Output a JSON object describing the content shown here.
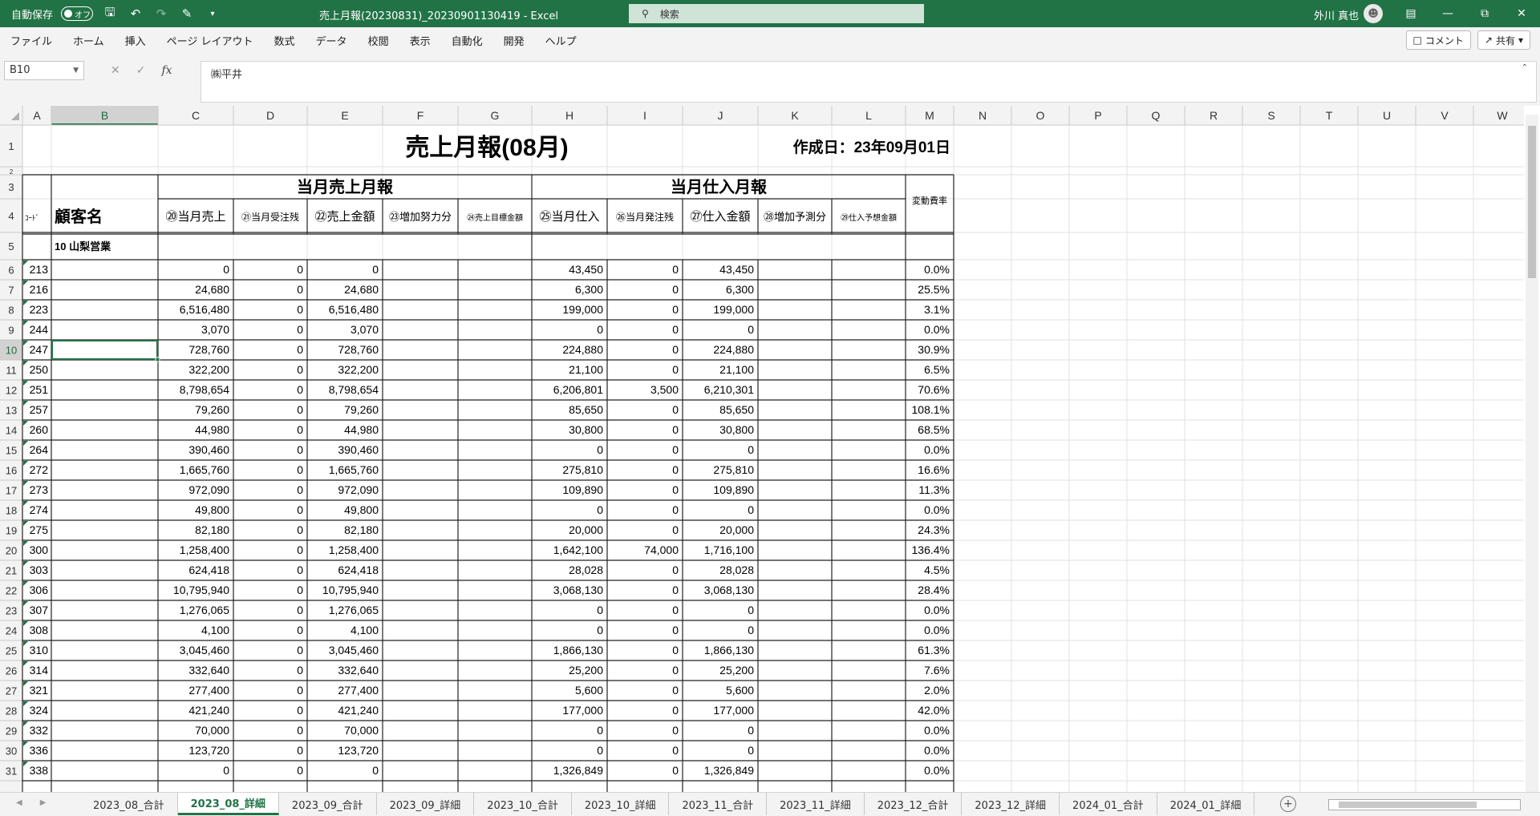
{
  "titlebar": {
    "autosave_label": "自動保存",
    "autosave_state": "オフ",
    "doc_title": "売上月報(20230831)_20230901130419  -  Excel",
    "search_placeholder": "検索",
    "user_name": "外川 真也"
  },
  "menu": [
    "ファイル",
    "ホーム",
    "挿入",
    "ページ レイアウト",
    "数式",
    "データ",
    "校閲",
    "表示",
    "自動化",
    "開発",
    "ヘルプ"
  ],
  "menu_right": {
    "comment": "コメント",
    "share": "共有"
  },
  "formula_bar": {
    "name_box": "B10",
    "formula": "㈱平井"
  },
  "columns": [
    "A",
    "B",
    "C",
    "D",
    "E",
    "F",
    "G",
    "H",
    "I",
    "J",
    "K",
    "L",
    "M",
    "N",
    "O",
    "P",
    "Q",
    "R",
    "S",
    "T",
    "U",
    "V",
    "W"
  ],
  "report": {
    "title": "売上月報(08月)",
    "created": "作成日：23年09月01日",
    "group_sales": "当月売上月報",
    "group_purchase": "当月仕入月報",
    "variable_cost_rate": "変動費率",
    "code": "ｺｰﾄﾞ",
    "customer": "顧客名",
    "col_headers": [
      "⑳当月売上",
      "㉑当月受注残",
      "㉒売上金額",
      "㉓増加努力分",
      "㉔売上目標金額",
      "㉕当月仕入",
      "㉖当月発注残",
      "㉗仕入金額",
      "㉘増加予測分",
      "㉙仕入予想金額"
    ],
    "section": "10 山梨営業"
  },
  "rows": [
    {
      "code": "213",
      "sales": "0",
      "order": "0",
      "amount": "0",
      "purchase": "43,450",
      "porder": "0",
      "pamount": "43,450",
      "rate": "0.0%"
    },
    {
      "code": "216",
      "sales": "24,680",
      "order": "0",
      "amount": "24,680",
      "purchase": "6,300",
      "porder": "0",
      "pamount": "6,300",
      "rate": "25.5%"
    },
    {
      "code": "223",
      "sales": "6,516,480",
      "order": "0",
      "amount": "6,516,480",
      "purchase": "199,000",
      "porder": "0",
      "pamount": "199,000",
      "rate": "3.1%"
    },
    {
      "code": "244",
      "sales": "3,070",
      "order": "0",
      "amount": "3,070",
      "purchase": "0",
      "porder": "0",
      "pamount": "0",
      "rate": "0.0%"
    },
    {
      "code": "247",
      "sales": "728,760",
      "order": "0",
      "amount": "728,760",
      "purchase": "224,880",
      "porder": "0",
      "pamount": "224,880",
      "rate": "30.9%"
    },
    {
      "code": "250",
      "sales": "322,200",
      "order": "0",
      "amount": "322,200",
      "purchase": "21,100",
      "porder": "0",
      "pamount": "21,100",
      "rate": "6.5%"
    },
    {
      "code": "251",
      "sales": "8,798,654",
      "order": "0",
      "amount": "8,798,654",
      "purchase": "6,206,801",
      "porder": "3,500",
      "pamount": "6,210,301",
      "rate": "70.6%"
    },
    {
      "code": "257",
      "sales": "79,260",
      "order": "0",
      "amount": "79,260",
      "purchase": "85,650",
      "porder": "0",
      "pamount": "85,650",
      "rate": "108.1%"
    },
    {
      "code": "260",
      "sales": "44,980",
      "order": "0",
      "amount": "44,980",
      "purchase": "30,800",
      "porder": "0",
      "pamount": "30,800",
      "rate": "68.5%"
    },
    {
      "code": "264",
      "sales": "390,460",
      "order": "0",
      "amount": "390,460",
      "purchase": "0",
      "porder": "0",
      "pamount": "0",
      "rate": "0.0%"
    },
    {
      "code": "272",
      "sales": "1,665,760",
      "order": "0",
      "amount": "1,665,760",
      "purchase": "275,810",
      "porder": "0",
      "pamount": "275,810",
      "rate": "16.6%"
    },
    {
      "code": "273",
      "sales": "972,090",
      "order": "0",
      "amount": "972,090",
      "purchase": "109,890",
      "porder": "0",
      "pamount": "109,890",
      "rate": "11.3%"
    },
    {
      "code": "274",
      "sales": "49,800",
      "order": "0",
      "amount": "49,800",
      "purchase": "0",
      "porder": "0",
      "pamount": "0",
      "rate": "0.0%"
    },
    {
      "code": "275",
      "sales": "82,180",
      "order": "0",
      "amount": "82,180",
      "purchase": "20,000",
      "porder": "0",
      "pamount": "20,000",
      "rate": "24.3%"
    },
    {
      "code": "300",
      "sales": "1,258,400",
      "order": "0",
      "amount": "1,258,400",
      "purchase": "1,642,100",
      "porder": "74,000",
      "pamount": "1,716,100",
      "rate": "136.4%"
    },
    {
      "code": "303",
      "sales": "624,418",
      "order": "0",
      "amount": "624,418",
      "purchase": "28,028",
      "porder": "0",
      "pamount": "28,028",
      "rate": "4.5%"
    },
    {
      "code": "306",
      "sales": "10,795,940",
      "order": "0",
      "amount": "10,795,940",
      "purchase": "3,068,130",
      "porder": "0",
      "pamount": "3,068,130",
      "rate": "28.4%"
    },
    {
      "code": "307",
      "sales": "1,276,065",
      "order": "0",
      "amount": "1,276,065",
      "purchase": "0",
      "porder": "0",
      "pamount": "0",
      "rate": "0.0%"
    },
    {
      "code": "308",
      "sales": "4,100",
      "order": "0",
      "amount": "4,100",
      "purchase": "0",
      "porder": "0",
      "pamount": "0",
      "rate": "0.0%"
    },
    {
      "code": "310",
      "sales": "3,045,460",
      "order": "0",
      "amount": "3,045,460",
      "purchase": "1,866,130",
      "porder": "0",
      "pamount": "1,866,130",
      "rate": "61.3%"
    },
    {
      "code": "314",
      "sales": "332,640",
      "order": "0",
      "amount": "332,640",
      "purchase": "25,200",
      "porder": "0",
      "pamount": "25,200",
      "rate": "7.6%"
    },
    {
      "code": "321",
      "sales": "277,400",
      "order": "0",
      "amount": "277,400",
      "purchase": "5,600",
      "porder": "0",
      "pamount": "5,600",
      "rate": "2.0%"
    },
    {
      "code": "324",
      "sales": "421,240",
      "order": "0",
      "amount": "421,240",
      "purchase": "177,000",
      "porder": "0",
      "pamount": "177,000",
      "rate": "42.0%"
    },
    {
      "code": "332",
      "sales": "70,000",
      "order": "0",
      "amount": "70,000",
      "purchase": "0",
      "porder": "0",
      "pamount": "0",
      "rate": "0.0%"
    },
    {
      "code": "336",
      "sales": "123,720",
      "order": "0",
      "amount": "123,720",
      "purchase": "0",
      "porder": "0",
      "pamount": "0",
      "rate": "0.0%"
    },
    {
      "code": "338",
      "sales": "0",
      "order": "0",
      "amount": "0",
      "purchase": "1,326,849",
      "porder": "0",
      "pamount": "1,326,849",
      "rate": "0.0%"
    }
  ],
  "sheets": [
    "2023_08_合計",
    "2023_08_詳細",
    "2023_09_合計",
    "2023_09_詳細",
    "2023_10_合計",
    "2023_10_詳細",
    "2023_11_合計",
    "2023_11_詳細",
    "2023_12_合計",
    "2023_12_詳細",
    "2024_01_合計",
    "2024_01_詳細"
  ],
  "active_sheet": "2023_08_詳細",
  "colors": {
    "excel_green": "#217346",
    "grid_line": "#d4d4d4",
    "header_bg": "#f3f3f3",
    "selected_header": "#d2d2d2"
  }
}
